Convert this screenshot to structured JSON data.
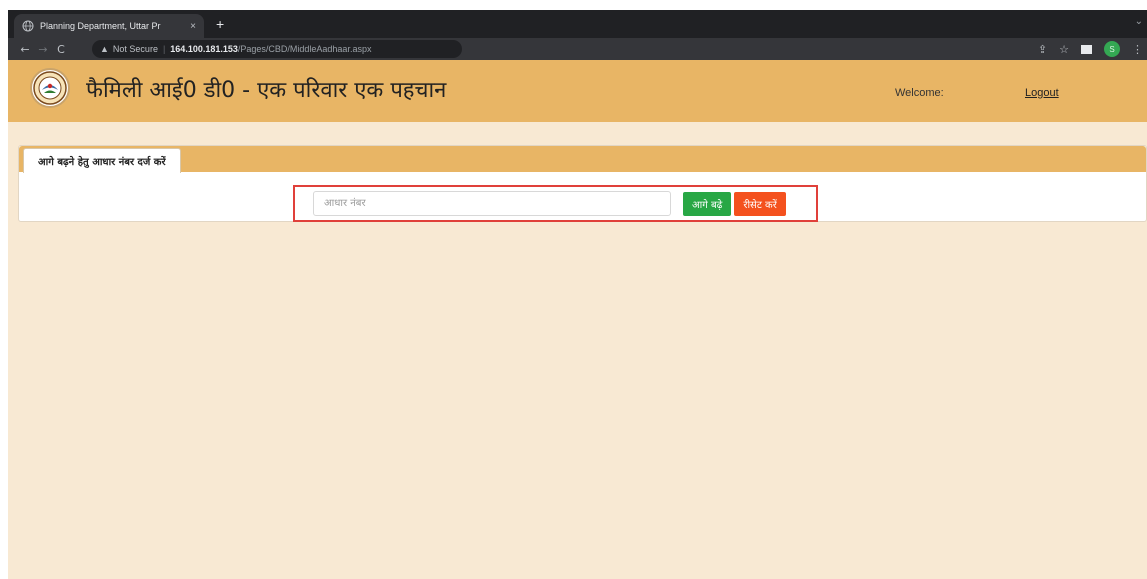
{
  "browser": {
    "tab_title": "Planning Department, Uttar Pr",
    "tab_close": "×",
    "new_tab": "+",
    "back": "←",
    "forward": "→",
    "reload": "C",
    "not_secure": "Not Secure",
    "separator": "|",
    "url_host": "164.100.181.153",
    "url_path": "/Pages/CBD/MiddleAadhaar.aspx",
    "profile_initial": "S"
  },
  "header": {
    "title": "फैमिली आई0 डी0 - एक परिवार एक पहचान",
    "welcome": "Welcome:",
    "logout": "Logout"
  },
  "panel": {
    "tab_label": "आगे बढ़ने हेतु आधार नंबर दर्ज करें",
    "input_placeholder": "आधार नंबर",
    "input_value": "",
    "next_button": "आगे बढ़े",
    "reset_button": "रीसेट करें"
  },
  "colors": {
    "header_bg": "#e8b565",
    "page_bg": "#f8e9d3",
    "next_button": "#28a745",
    "reset_button": "#f4511e",
    "highlight_border": "#e0403a"
  }
}
